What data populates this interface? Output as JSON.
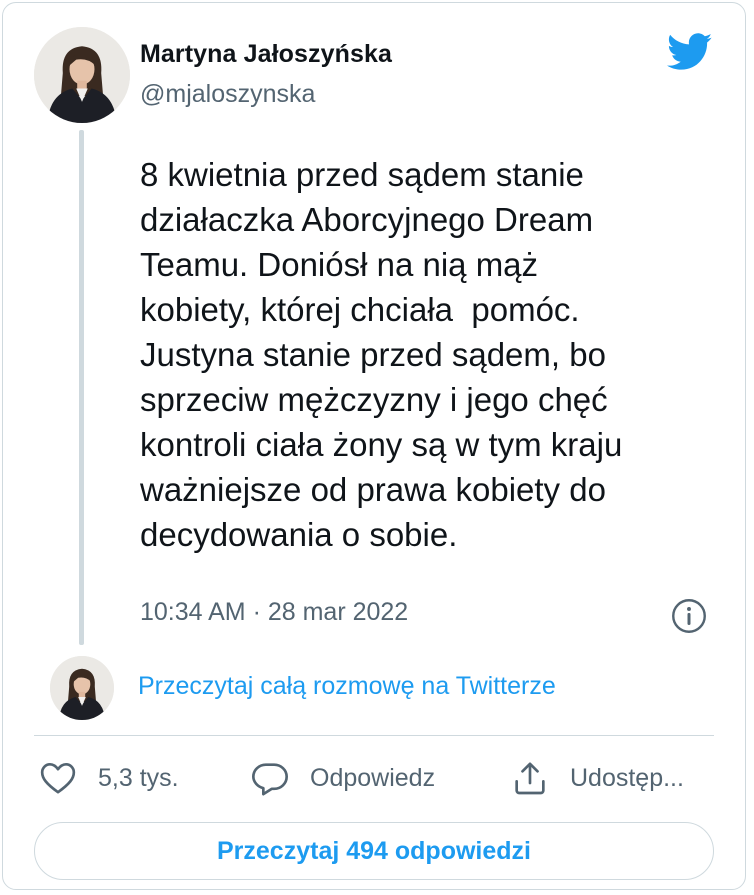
{
  "author": {
    "name": "Martyna Jałoszyńska",
    "handle": "@mjaloszynska"
  },
  "tweet": {
    "lines": [
      "8 kwietnia przed sądem stanie",
      "działaczka Aborcyjnego Dream",
      "Teamu. Doniósł na nią mąż",
      "kobiety, której chciała  pomóc.",
      "Justyna stanie przed sądem, bo",
      "sprzeciw mężczyzny i jego chęć",
      "kontroli ciała żony są w tym kraju",
      "ważniejsze od prawa kobiety do",
      "decydowania o sobie."
    ],
    "timestamp": "10:34 AM · 28 mar 2022"
  },
  "conversation": {
    "read_thread_label": "Przeczytaj całą rozmowę na Twitterze"
  },
  "actions": {
    "like_count": "5,3 tys.",
    "reply_label": "Odpowiedz",
    "share_label": "Udostęp..."
  },
  "replies_button_label": "Przeczytaj 494 odpowiedzi",
  "icons": {
    "brand": "twitter-bird-icon",
    "info": "info-icon",
    "like": "heart-icon",
    "reply": "speech-bubble-icon",
    "share": "share-icon"
  },
  "colors": {
    "accent": "#1d9bf0",
    "text": "#0f1419",
    "secondary_text": "#536471",
    "border": "#cfd9de"
  }
}
